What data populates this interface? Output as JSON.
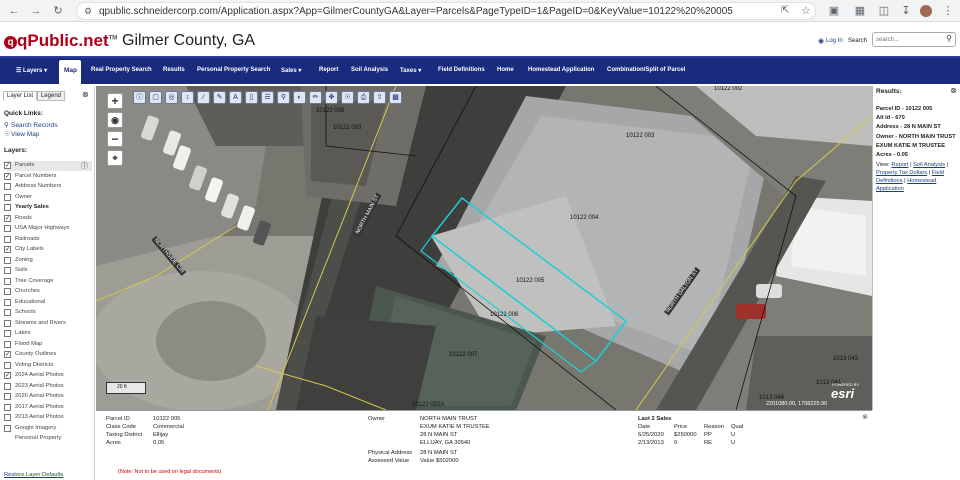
{
  "browser": {
    "url": "qpublic.schneidercorp.com/Application.aspx?App=GilmerCountyGA&Layer=Parcels&PageTypeID=1&PageID=0&KeyValue=10122%20%20005"
  },
  "header": {
    "logo": "qPublic.net",
    "logo_tm": "TM",
    "county": "Gilmer County, GA",
    "login": "Log In",
    "search_label": "Search",
    "search_placeholder": "search..."
  },
  "nav": {
    "items": [
      "Layers",
      "Map",
      "Real Property Search",
      "Results",
      "Personal Property Search",
      "Sales",
      "Report",
      "Soil Analysis",
      "Taxes",
      "Field Definitions",
      "Home",
      "Homestead Application",
      "Combination/Split of Parcel"
    ]
  },
  "left": {
    "tabs": [
      "Layer List",
      "Legend"
    ],
    "quick_links_title": "Quick Links:",
    "quick_links": [
      "Search Records",
      "View Map"
    ],
    "layers_title": "Layers:",
    "layers": [
      {
        "label": "Parcels",
        "checked": true,
        "bold": false
      },
      {
        "label": "Parcel Numbers",
        "checked": true,
        "bold": false
      },
      {
        "label": "Address Numbers",
        "checked": false,
        "bold": false
      },
      {
        "label": "Owner",
        "checked": false,
        "bold": false
      },
      {
        "label": "Yearly Sales",
        "checked": false,
        "bold": true
      },
      {
        "label": "Roads",
        "checked": true,
        "bold": false
      },
      {
        "label": "USA Major Highways",
        "checked": false,
        "bold": false
      },
      {
        "label": "Railroads",
        "checked": false,
        "bold": false
      },
      {
        "label": "City Labels",
        "checked": true,
        "bold": false
      },
      {
        "label": "Zoning",
        "checked": false,
        "bold": false
      },
      {
        "label": "Soils",
        "checked": false,
        "bold": false
      },
      {
        "label": "Tree Coverage",
        "checked": false,
        "bold": false
      },
      {
        "label": "Churches",
        "checked": false,
        "bold": false
      },
      {
        "label": "Educational",
        "checked": false,
        "bold": false
      },
      {
        "label": "Schools",
        "checked": false,
        "bold": false
      },
      {
        "label": "Streams and Rivers",
        "checked": false,
        "bold": false
      },
      {
        "label": "Lakes",
        "checked": false,
        "bold": false
      },
      {
        "label": "Flood Map",
        "checked": false,
        "bold": false
      },
      {
        "label": "County Outlines",
        "checked": true,
        "bold": false
      },
      {
        "label": "Voting Districts",
        "checked": false,
        "bold": false
      },
      {
        "label": "2024 Aerial Photos",
        "checked": true,
        "bold": false
      },
      {
        "label": "2023 Aerial Photos",
        "checked": false,
        "bold": false
      },
      {
        "label": "2020 Aerial Photos",
        "checked": false,
        "bold": false
      },
      {
        "label": "2017 Aerial Photos",
        "checked": false,
        "bold": false
      },
      {
        "label": "2013 Aerial Photos",
        "checked": false,
        "bold": false
      },
      {
        "label": "Google Imagery",
        "checked": false,
        "bold": false
      },
      {
        "label": "Personal Property",
        "checked": null,
        "bold": false
      }
    ],
    "restore": "Restore Layer Defaults"
  },
  "map": {
    "parcel_labels": [
      "10122 005",
      "10122 004",
      "10122 003",
      "10122 006",
      "10122 007",
      "10122 002",
      "10122 008",
      "10122 002A",
      "1013 043",
      "1013 041",
      "1013 046"
    ],
    "street_labels": [
      "NORTH MAIN ST",
      "NORTHSIDE CIR",
      "NORTH DALTON ST"
    ],
    "scale": "20 ft",
    "coords": "2201080.00, 1708225.90",
    "esri_powered": "POWERED BY",
    "esri": "esri"
  },
  "results": {
    "title": "Results:",
    "parcel_id": "Parcel ID - 10122 005",
    "alt_id": "Alt Id - 670",
    "address": "Address - 28 N MAIN ST",
    "owner": "Owner - NORTH MAIN TRUST EXUM KATIE M TRUSTEE",
    "acres": "Acres - 0.05",
    "view_label": "View:",
    "links": [
      "Report",
      "Soil Analysis",
      "Property Tax Dollars",
      "Field Definitions",
      "Homestead Application"
    ]
  },
  "details": {
    "labels": [
      "Parcel ID",
      "Class Code",
      "Taxing District",
      "Acres"
    ],
    "values": [
      "10122 005",
      "Commercial",
      "Ellijay",
      "0.05"
    ],
    "owner_label": "Owner",
    "owner_lines": [
      "NORTH MAIN TRUST",
      "EXUM KATIE M TRUSTEE",
      "28 N MAIN ST",
      "ELLIJAY, GA 30540"
    ],
    "phys_label": "Physical Address",
    "phys_value": "28 N MAIN ST",
    "assessed_label": "Assessed Value",
    "assessed_value": "Value $502000",
    "sales_title": "Last 2 Sales",
    "sales_headers": [
      "Date",
      "Price",
      "Reason",
      "Qual"
    ],
    "sales": [
      [
        "6/25/2020",
        "$250000",
        "PP",
        "U"
      ],
      [
        "2/13/2013",
        "0",
        "RE",
        "U"
      ]
    ],
    "note": "(Note: Not to be used on legal documents)"
  }
}
